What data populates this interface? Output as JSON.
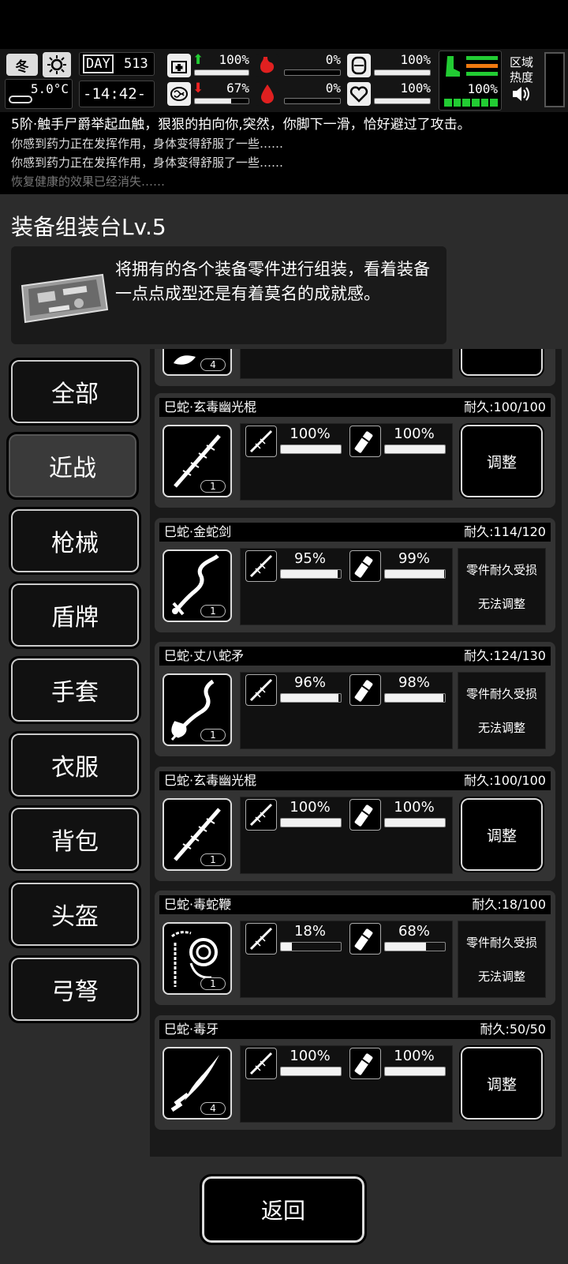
{
  "hud": {
    "season": "冬",
    "temperature": "5.0°C",
    "day_label": "DAY",
    "day_number": "513",
    "clock": "-14:42-",
    "stats": [
      {
        "name": "health",
        "value": "100%",
        "fraction": 1.0
      },
      {
        "name": "brain",
        "value": "67%",
        "fraction": 0.67
      },
      {
        "name": "stomach",
        "value": "0%",
        "fraction": 0.0
      },
      {
        "name": "bleeding",
        "value": "0%",
        "fraction": 0.0
      },
      {
        "name": "armor",
        "value": "100%",
        "fraction": 1.0
      },
      {
        "name": "heart",
        "value": "100%",
        "fraction": 1.0
      },
      {
        "name": "stamina",
        "value": "100%",
        "fraction": 1.0
      }
    ],
    "zone_heat": "区域热度",
    "colors": {
      "arrow_up": "#22cc33",
      "arrow_down": "#ee2222",
      "organ_red": "#e02020",
      "stamina_green": "#22cc33",
      "stamina_orange": "#f07a10"
    }
  },
  "log": [
    "5阶·触手尸爵举起血触，狠狠的拍向你,突然，你脚下一滑，恰好避过了攻击。",
    "你感到药力正在发挥作用，身体变得舒服了一些……",
    "你感到药力正在发挥作用，身体变得舒服了一些……",
    "恢复健康的效果已经消失……"
  ],
  "panel": {
    "title": "装备组装台Lv.5",
    "description": "将拥有的各个装备零件进行组装，看着装备一点点成型还是有着莫名的成就感。"
  },
  "categories": [
    "全部",
    "近战",
    "枪械",
    "盾牌",
    "手套",
    "衣服",
    "背包",
    "头盔",
    "弓弩"
  ],
  "active_category": "近战",
  "partial_card": {
    "count": "4"
  },
  "items": [
    {
      "name": "巳蛇·玄毒幽光棍",
      "durability": "耐久:100/100",
      "count": "1",
      "p1": "100%",
      "p1f": 1.0,
      "p2": "100%",
      "p2f": 1.0,
      "action": "调整",
      "blocked": false
    },
    {
      "name": "巳蛇·金蛇剑",
      "durability": "耐久:114/120",
      "count": "1",
      "p1": "95%",
      "p1f": 0.95,
      "p2": "99%",
      "p2f": 0.99,
      "blocked": true,
      "blocked_line1": "零件耐久受损",
      "blocked_line2": "无法调整"
    },
    {
      "name": "巳蛇·丈八蛇矛",
      "durability": "耐久:124/130",
      "count": "1",
      "p1": "96%",
      "p1f": 0.96,
      "p2": "98%",
      "p2f": 0.98,
      "blocked": true,
      "blocked_line1": "零件耐久受损",
      "blocked_line2": "无法调整"
    },
    {
      "name": "巳蛇·玄毒幽光棍",
      "durability": "耐久:100/100",
      "count": "1",
      "p1": "100%",
      "p1f": 1.0,
      "p2": "100%",
      "p2f": 1.0,
      "action": "调整",
      "blocked": false
    },
    {
      "name": "巳蛇·毒蛇鞭",
      "durability": "耐久:18/100",
      "count": "1",
      "p1": "18%",
      "p1f": 0.18,
      "p2": "68%",
      "p2f": 0.68,
      "blocked": true,
      "blocked_line1": "零件耐久受损",
      "blocked_line2": "无法调整"
    },
    {
      "name": "巳蛇·毒牙",
      "durability": "耐久:50/50",
      "count": "4",
      "p1": "100%",
      "p1f": 1.0,
      "p2": "100%",
      "p2f": 1.0,
      "action": "调整",
      "blocked": false
    }
  ],
  "back_label": "返回"
}
